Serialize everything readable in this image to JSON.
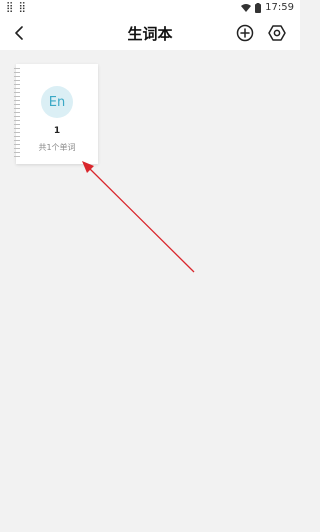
{
  "status_bar": {
    "left_glyphs": "⣿ ⣿",
    "time": "17:59",
    "icons": [
      "wifi-icon",
      "battery-icon"
    ]
  },
  "header": {
    "title": "生词本",
    "back_icon": "chevron-left-icon",
    "add_icon": "plus-circle-icon",
    "settings_icon": "settings-icon"
  },
  "notebooks": [
    {
      "lang_label": "En",
      "name": "1",
      "count_text": "共1个单词"
    }
  ],
  "colors": {
    "background": "#f2f2f2",
    "lang_circle_bg": "#dbeff5",
    "lang_text": "#3ba9c6",
    "annotation_arrow": "#d9262c"
  }
}
